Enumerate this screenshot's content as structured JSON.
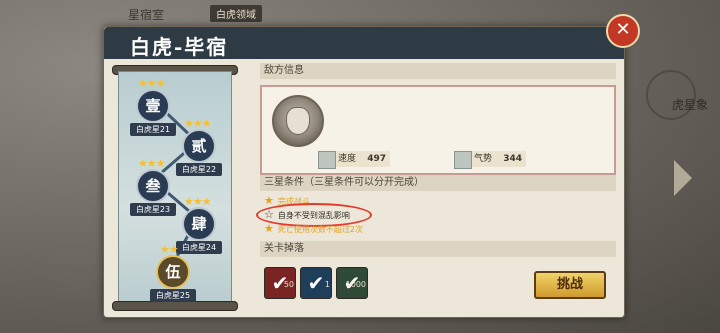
{
  "background": {
    "top_label": "星宿室",
    "top_tab": "白虎领域",
    "right_label": "虎星象"
  },
  "modal": {
    "title": "白虎-毕宿"
  },
  "map": {
    "nodes": [
      {
        "char": "壹",
        "label": "白虎星21",
        "stars": "★★★"
      },
      {
        "char": "贰",
        "label": "白虎星22",
        "stars": "★★★"
      },
      {
        "char": "叁",
        "label": "白虎星23",
        "stars": "★★★"
      },
      {
        "char": "肆",
        "label": "白虎星24",
        "stars": "★★★"
      },
      {
        "char": "伍",
        "label": "白虎星25",
        "stars": "★★"
      }
    ]
  },
  "enemy": {
    "section_title": "敌方信息",
    "stats": [
      {
        "icon": "speed-icon",
        "name": "速度",
        "value": "497"
      },
      {
        "icon": "momentum-icon",
        "name": "气势",
        "value": "344"
      }
    ]
  },
  "conditions": {
    "section_title": "三星条件（三星条件可以分开完成）",
    "items": [
      {
        "text": "完成战斗",
        "achieved": true,
        "color": "#e0a020"
      },
      {
        "text": "自身不受到混乱影响",
        "achieved": false,
        "color": "#2f2a24"
      },
      {
        "text": "死亡使用次数不超过2次",
        "achieved": true,
        "color": "#e0a020"
      }
    ]
  },
  "drops": {
    "section_title": "关卡掉落",
    "items": [
      {
        "color": "#7a2424",
        "count": "50"
      },
      {
        "color": "#1e3e5a",
        "count": "1"
      },
      {
        "color": "#2f4a36",
        "count": "1000"
      }
    ]
  },
  "buttons": {
    "close": "✕",
    "challenge": "挑战"
  }
}
